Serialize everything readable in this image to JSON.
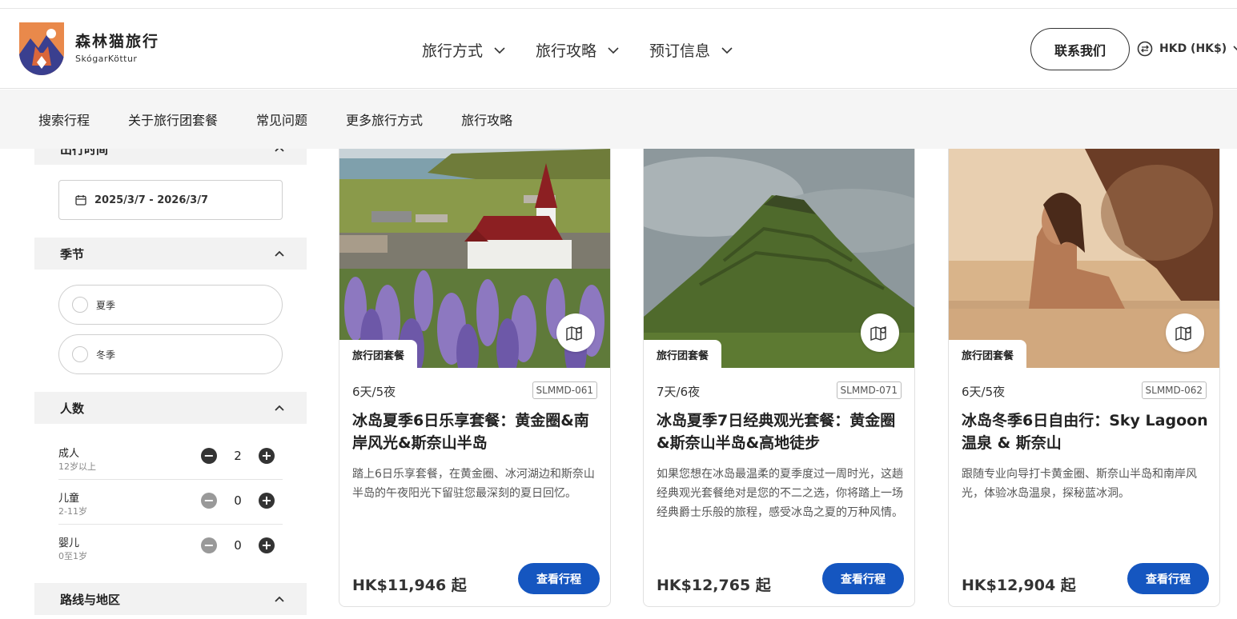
{
  "brand": {
    "name_cn": "森林猫旅行",
    "name_en": "SkógarKöttur",
    "logo_icon": "forest-cat-logo"
  },
  "nav": [
    {
      "label": "旅行方式"
    },
    {
      "label": "旅行攻略"
    },
    {
      "label": "预订信息"
    }
  ],
  "header": {
    "contact_label": "联系我们",
    "currency_label": "HKD (HK$)"
  },
  "subnav": [
    "搜索行程",
    "关于旅行团套餐",
    "常见问题",
    "更多旅行方式",
    "旅行攻略"
  ],
  "sidebar": {
    "date_section_title": "出行时间",
    "date_range": "2025/3/7 - 2026/3/7",
    "season_title": "季节",
    "seasons": [
      "夏季",
      "冬季"
    ],
    "people_title": "人数",
    "people": [
      {
        "label": "成人",
        "sub": "12岁以上",
        "value": "2"
      },
      {
        "label": "儿童",
        "sub": "2-11岁",
        "value": "0"
      },
      {
        "label": "婴儿",
        "sub": "0至1岁",
        "value": "0"
      }
    ],
    "route_title": "路线与地区"
  },
  "cards": [
    {
      "tag": "旅行团套餐",
      "duration": "6天/5夜",
      "code": "SLMMD-061",
      "title": "冰岛夏季6日乐享套餐：黄金圈&南岸风光&斯奈山半岛",
      "desc": "踏上6日乐享套餐，在黄金圈、冰河湖边和斯奈山半岛的午夜阳光下留驻您最深刻的夏日回忆。",
      "price": "HK$11,946 起",
      "button": "查看行程",
      "image": "church-lupine-field"
    },
    {
      "tag": "旅行团套餐",
      "duration": "7天/6夜",
      "code": "SLMMD-071",
      "title": "冰岛夏季7日经典观光套餐：黄金圈&斯奈山半岛&高地徒步",
      "desc": "如果您想在冰岛最温柔的夏季度过一周时光，这趟经典观光套餐绝对是您的不二之选，你将踏上一场经典爵士乐般的旅程，感受冰岛之夏的万种风情。",
      "price": "HK$12,765 起",
      "button": "查看行程",
      "image": "kirkjufell-mountain"
    },
    {
      "tag": "旅行团套餐",
      "duration": "6天/5夜",
      "code": "SLMMD-062",
      "title": "冰岛冬季6日自由行：Sky Lagoon温泉 & 斯奈山",
      "desc": "跟随专业向导打卡黄金圈、斯奈山半岛和南岸风光，体验冰岛温泉，探秘蓝冰洞。",
      "price": "HK$12,904 起",
      "button": "查看行程",
      "image": "woman-hot-spring"
    }
  ],
  "colors": {
    "primary_button": "#1556c0",
    "section_bg": "#f2f2f2"
  }
}
